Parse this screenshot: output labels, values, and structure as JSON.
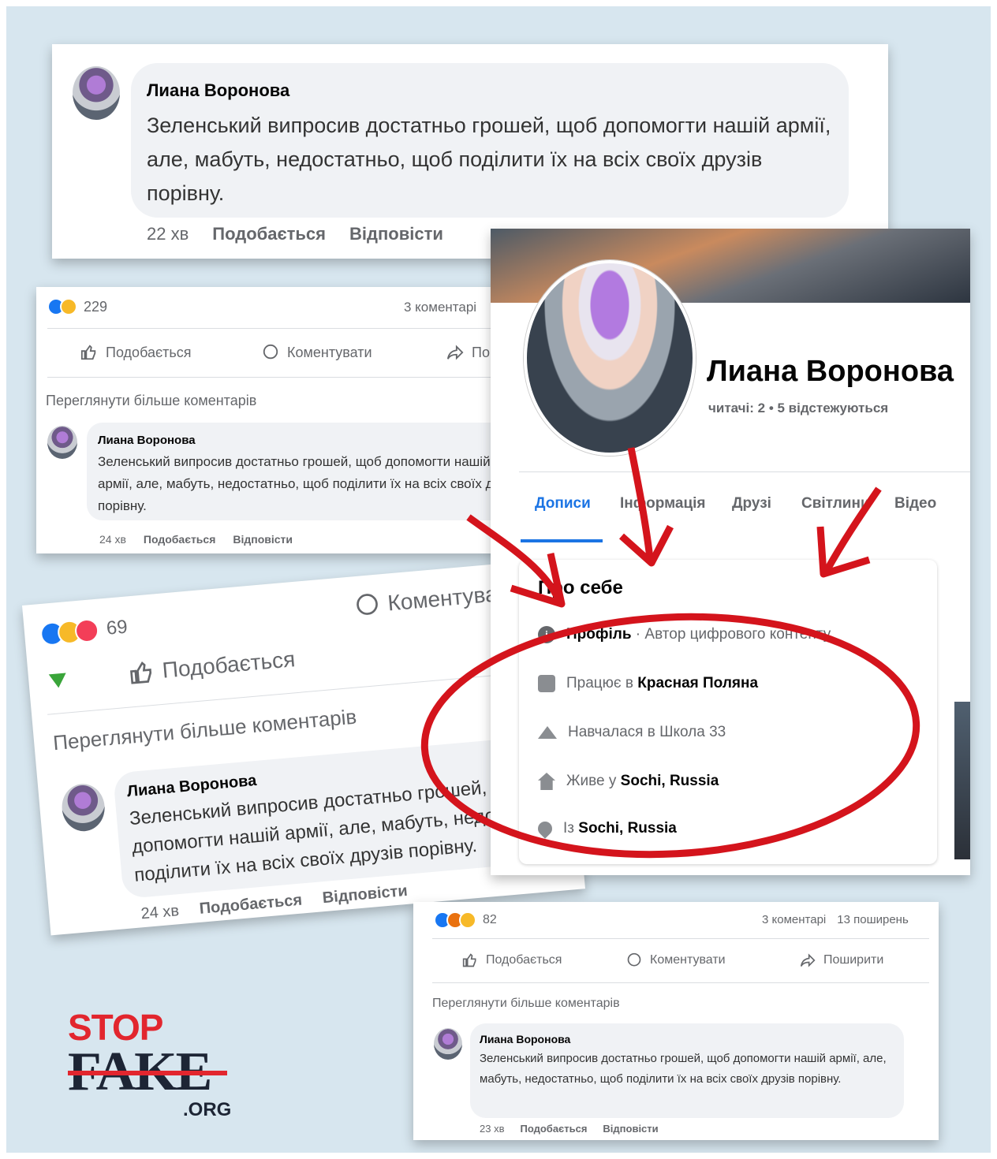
{
  "comment": {
    "author": "Лиана Воронова",
    "text": "Зеленський випросив достатньо грошей, щоб допомогти нашій армії, але, мабуть, недостатньо, щоб поділити їх на всіх своїх друзів порівну."
  },
  "top_card": {
    "time": "22 хв",
    "like": "Подобається",
    "reply": "Відповісти"
  },
  "post1": {
    "reactions_count": "229",
    "comments": "3 коментарі",
    "like_btn": "Подобається",
    "comment_btn": "Коментувати",
    "share_btn_partial": "По",
    "more_comments": "Переглянути більше коментарів",
    "time": "24 хв",
    "like": "Подобається",
    "reply": "Відповісти"
  },
  "post2": {
    "reactions_count": "69",
    "like_btn": "Подобається",
    "comment_btn": "Коментувати",
    "more_comments": "Переглянути більше коментарів",
    "time": "24 хв",
    "like": "Подобається",
    "reply": "Відповісти"
  },
  "post3": {
    "reactions_count": "82",
    "comments": "3 коментарі",
    "shares": "13 поширень",
    "like_btn": "Подобається",
    "comment_btn": "Коментувати",
    "share_btn": "Поширити",
    "more_comments": "Переглянути більше коментарів",
    "time": "23 хв",
    "like": "Подобається",
    "reply": "Відповісти"
  },
  "profile": {
    "name": "Лиана Воронова",
    "followers": "читачі: 2 • 5 відстежуються",
    "tabs": [
      "Дописи",
      "Інформація",
      "Друзі",
      "Світлини",
      "Відео"
    ],
    "about_title": "Про себе",
    "rows": [
      {
        "icon": "info-icon",
        "label": "Профіль",
        "value": " · Автор цифрового контенту"
      },
      {
        "icon": "briefcase-icon",
        "label": "Працює в ",
        "value": "Красная Поляна"
      },
      {
        "icon": "graduation-cap-icon",
        "label": "Навчалася в Школа 33",
        "value": ""
      },
      {
        "icon": "home-icon",
        "label": "Живе у ",
        "value": "Sochi, Russia"
      },
      {
        "icon": "location-pin-icon",
        "label": "Із ",
        "value": "Sochi, Russia"
      }
    ]
  },
  "logo": {
    "stop": "STOP",
    "fake": "FAKE",
    "org": ".ORG"
  },
  "colors": {
    "accent_blue": "#1b74e4",
    "annotation_red": "#d4141c",
    "logo_red": "#e2262e",
    "background": "#d7e6ef"
  }
}
